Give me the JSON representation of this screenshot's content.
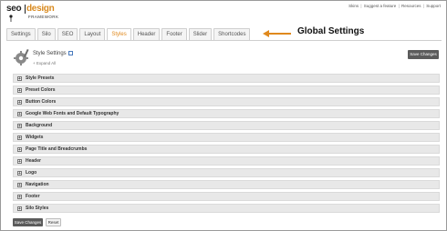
{
  "header": {
    "logo_seo": "seo",
    "logo_design": "design",
    "logo_framework": "FRAMEWORK",
    "links": [
      "Skins",
      "Suggest a feature",
      "Resources",
      "Support"
    ]
  },
  "tabs": [
    {
      "label": "Settings",
      "active": false
    },
    {
      "label": "Silo",
      "active": false
    },
    {
      "label": "SEO",
      "active": false
    },
    {
      "label": "Layout",
      "active": false
    },
    {
      "label": "Styles",
      "active": true
    },
    {
      "label": "Header",
      "active": false
    },
    {
      "label": "Footer",
      "active": false
    },
    {
      "label": "Slider",
      "active": false
    },
    {
      "label": "Shortcodes",
      "active": false
    }
  ],
  "annotation": {
    "text": "Global Settings",
    "color": "#e0891d"
  },
  "style_settings": {
    "title": "Style Settings",
    "expand_all": "+ Expand All",
    "save_label": "Save Changes"
  },
  "sections": [
    "Style Presets",
    "Preset Colors",
    "Button Colors",
    "Google Web Fonts and Default Typography",
    "Background",
    "Widgets",
    "Page Title and Breadcrumbs",
    "Header",
    "Logo",
    "Navigation",
    "Footer",
    "Silo Styles"
  ],
  "footer_buttons": {
    "save": "Save Changes",
    "reset": "Reset"
  },
  "colors": {
    "accent": "#e0891d",
    "dark_button": "#5b5b5b"
  }
}
